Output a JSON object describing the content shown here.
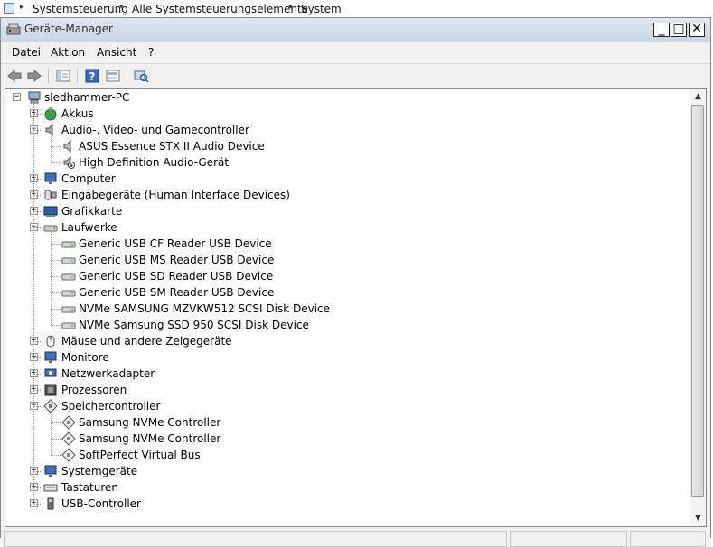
{
  "explorer_bar": {
    "breadcrumb": [
      "Systemsteuerung",
      "Alle Systemsteuerungselemente",
      "System"
    ]
  },
  "window": {
    "title": "Geräte-Manager",
    "minimize_label": "_",
    "maximize_label": "□",
    "close_label": "✕"
  },
  "menu": [
    "Datei",
    "Aktion",
    "Ansicht",
    "?"
  ],
  "toolbar": {
    "buttons": [
      "back-arrow-icon",
      "forward-arrow-icon",
      "properties-icon",
      "help-icon",
      "view-icon",
      "scan-hardware-icon"
    ]
  },
  "tree": {
    "root": "sledhammer-PC",
    "items": [
      {
        "label": "Akkus",
        "icon": "battery-icon",
        "expanded": false,
        "children": []
      },
      {
        "label": "Audio-, Video- und Gamecontroller",
        "icon": "speaker-icon",
        "expanded": true,
        "children": [
          "ASUS Essence STX II Audio Device",
          "High Definition Audio-Gerät"
        ]
      },
      {
        "label": "Computer",
        "icon": "computer-icon",
        "expanded": false,
        "children": []
      },
      {
        "label": "Eingabegeräte (Human Interface Devices)",
        "icon": "hid-icon",
        "expanded": false,
        "children": []
      },
      {
        "label": "Grafikkarte",
        "icon": "display-adapter-icon",
        "expanded": false,
        "children": []
      },
      {
        "label": "Laufwerke",
        "icon": "drive-icon",
        "expanded": true,
        "children": [
          "Generic USB CF Reader USB Device",
          "Generic USB MS Reader USB Device",
          "Generic USB SD Reader USB Device",
          "Generic USB SM Reader USB Device",
          "NVMe SAMSUNG MZVKW512 SCSI Disk Device",
          "NVMe Samsung SSD 950 SCSI Disk Device"
        ]
      },
      {
        "label": "Mäuse und andere Zeigegeräte",
        "icon": "mouse-icon",
        "expanded": false,
        "children": []
      },
      {
        "label": "Monitore",
        "icon": "monitor-icon",
        "expanded": false,
        "children": []
      },
      {
        "label": "Netzwerkadapter",
        "icon": "network-adapter-icon",
        "expanded": false,
        "children": []
      },
      {
        "label": "Prozessoren",
        "icon": "processor-icon",
        "expanded": false,
        "children": []
      },
      {
        "label": "Speichercontroller",
        "icon": "storage-controller-icon",
        "expanded": true,
        "children": [
          "Samsung NVMe Controller",
          "Samsung NVMe Controller",
          "SoftPerfect Virtual Bus"
        ]
      },
      {
        "label": "Systemgeräte",
        "icon": "system-devices-icon",
        "expanded": false,
        "children": []
      },
      {
        "label": "Tastaturen",
        "icon": "keyboard-icon",
        "expanded": false,
        "children": []
      },
      {
        "label": "USB-Controller",
        "icon": "usb-icon",
        "expanded": false,
        "children": []
      }
    ]
  },
  "colors": {
    "titlebar": "#c9d6e5",
    "window_bg": "#f0f0f0",
    "tree_bg": "#ffffff"
  }
}
